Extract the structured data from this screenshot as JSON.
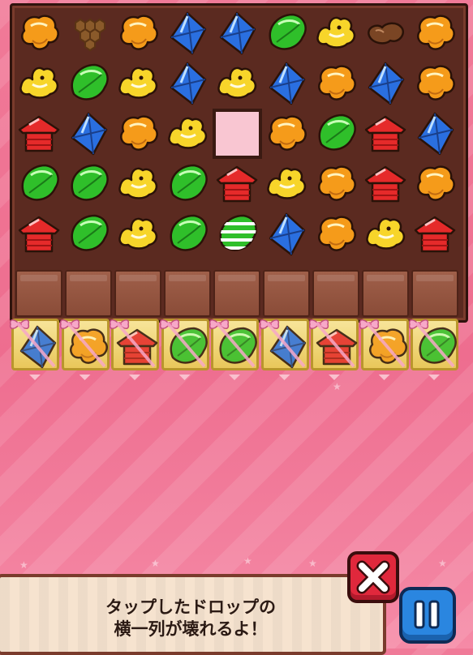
{
  "board": {
    "rows": [
      [
        "flower",
        "honeycomb",
        "flower",
        "diamond",
        "diamond",
        "leaf",
        "bird",
        "peanut",
        "flower"
      ],
      [
        "bird",
        "leaf",
        "bird",
        "diamond",
        "bird",
        "diamond",
        "flower",
        "diamond",
        "flower"
      ],
      [
        "house",
        "diamond",
        "flower",
        "bird",
        "empty",
        "flower",
        "leaf",
        "house",
        "diamond"
      ],
      [
        "leaf",
        "leaf",
        "bird",
        "leaf",
        "house",
        "bird",
        "flower",
        "house",
        "flower"
      ],
      [
        "house",
        "leaf",
        "bird",
        "leaf",
        "leaf-striped",
        "diamond",
        "flower",
        "bird",
        "house"
      ]
    ],
    "gift_row": [
      "diamond",
      "flower",
      "house",
      "leaf",
      "leaf",
      "diamond",
      "house",
      "flower",
      "leaf"
    ]
  },
  "colors": {
    "flower": "#f59b1a",
    "bird": "#f7d52a",
    "diamond": "#2a6fe0",
    "leaf": "#2fbf2a",
    "house": "#e52a2a",
    "board_bg": "#5b2a20",
    "pale_cell": "#f9c6d2"
  },
  "message": {
    "line1": "タップしたドロップの",
    "line2": "横一列が壊れるよ！"
  },
  "buttons": {
    "close_icon": "close-x-icon",
    "pause_icon": "pause-icon"
  }
}
